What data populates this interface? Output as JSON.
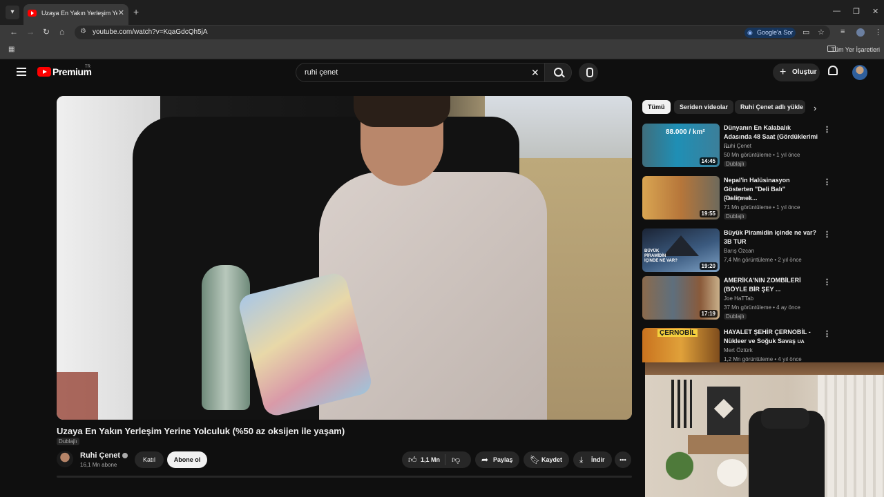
{
  "browser": {
    "tab_title": "Uzaya En Yakın Yerleşim Yerine",
    "url": "youtube.com/watch?v=KqaGdcQh5jA",
    "google_ask": "Google'a Sor",
    "bookmarks_all": "Tüm Yer İşaretleri"
  },
  "header": {
    "logo_text": "Premium",
    "logo_region": "TR",
    "search_value": "ruhi çenet",
    "create_label": "Oluştur"
  },
  "video": {
    "title": "Uzaya En Yakın Yerleşim Yerine Yolculuk (%50 az oksijen ile yaşam)",
    "dub_label": "Dublajlı",
    "channel_name": "Ruhi Çenet",
    "subscribers": "16,1 Mn abone",
    "join_label": "Katıl",
    "subscribe_label": "Abone ol",
    "likes": "1,1 Mn",
    "share_label": "Paylaş",
    "save_label": "Kaydet",
    "download_label": "İndir"
  },
  "chips": [
    "Tümü",
    "Seriden videolar",
    "Ruhi Çenet adlı yükle"
  ],
  "recommendations": [
    {
      "title": "Dünyanın En Kalabalık Adasında 48 Saat (Gördüklerimi ...",
      "channel": "Ruhi Çenet",
      "meta": "50 Mn görüntüleme • 1 yıl önce",
      "duration": "14:45",
      "badge": "Dublajlı",
      "thumb_text": "88.000 / km²"
    },
    {
      "title": "Nepal'in Halüsinasyon Gösterten \"Deli Balı\" (Delirmek...",
      "channel": "Ruhi Çenet",
      "meta": "71 Mn görüntüleme • 1 yıl önce",
      "duration": "19:55",
      "badge": "Dublajlı",
      "thumb_text": ""
    },
    {
      "title": "Büyük Piramidin içinde ne var? 3B TUR",
      "channel": "Barış Özcan",
      "meta": "7,4 Mn görüntüleme • 2 yıl önce",
      "duration": "19:20",
      "badge": "",
      "thumb_text": "BÜYÜK PİRAMİDİN İÇİNDE NE VAR?"
    },
    {
      "title": "AMERİKA'NIN ZOMBİLERİ (BÖYLE BİR ŞEY ...",
      "channel": "Joe HaTTab",
      "meta": "37 Mn görüntüleme • 4 ay önce",
      "duration": "17:19",
      "badge": "Dublajlı",
      "thumb_text": ""
    },
    {
      "title": "HAYALET ŞEHİR ÇERNOBİL - Nükleer ve Soğuk Savaş",
      "channel": "Mert Öztürk",
      "meta": "1,2 Mn görüntüleme • 4 yıl önce",
      "duration": "",
      "badge": "",
      "thumb_text": "ÇERNOBİL",
      "suffix": "UA"
    }
  ]
}
